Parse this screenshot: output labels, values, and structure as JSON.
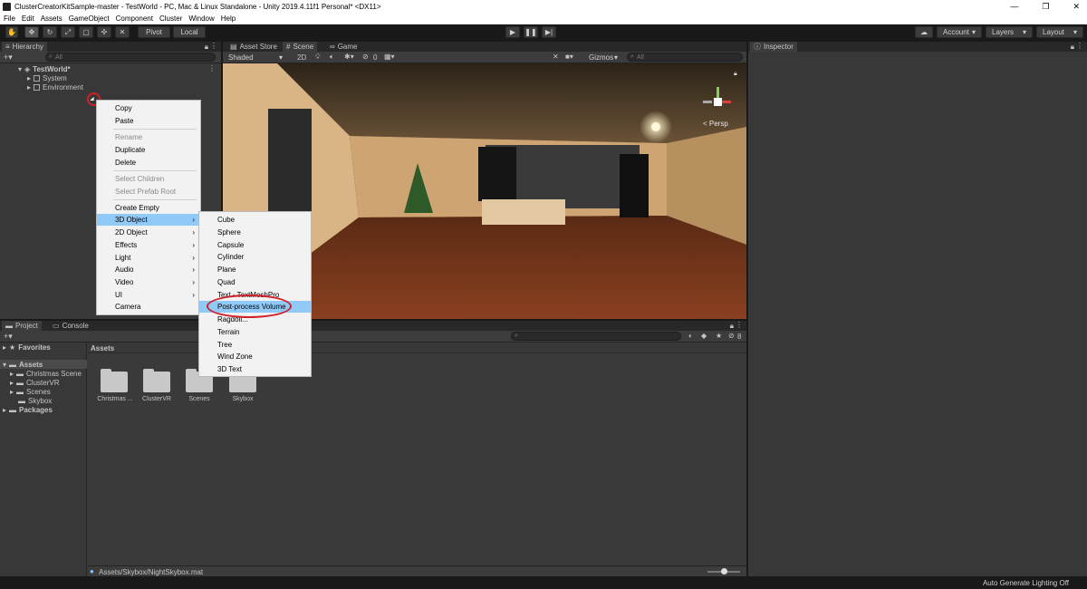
{
  "window": {
    "title": "ClusterCreatorKitSample-master - TestWorld - PC, Mac & Linux Standalone - Unity 2019.4.11f1 Personal* <DX11>"
  },
  "menubar": [
    "File",
    "Edit",
    "Assets",
    "GameObject",
    "Component",
    "Cluster",
    "Window",
    "Help"
  ],
  "toolbar": {
    "pivot": "Pivot",
    "local": "Local",
    "account": "Account",
    "layers": "Layers",
    "layout": "Layout"
  },
  "hierarchy": {
    "tab": "Hierarchy",
    "search_placeholder": "All",
    "scene": "TestWorld*",
    "items": [
      "System",
      "Environment"
    ]
  },
  "scene_view": {
    "tabs": [
      "Asset Store",
      "Scene",
      "Game"
    ],
    "shading": "Shaded",
    "mode_2d": "2D",
    "hidden_count": "0",
    "gizmos": "Gizmos",
    "search_placeholder": "All",
    "persp_label": "< Persp"
  },
  "inspector": {
    "tab": "Inspector"
  },
  "context_menu": {
    "items": [
      {
        "label": "Copy",
        "disabled": false
      },
      {
        "label": "Paste",
        "disabled": false
      },
      {
        "label": "Rename",
        "disabled": true
      },
      {
        "label": "Duplicate",
        "disabled": false
      },
      {
        "label": "Delete",
        "disabled": false
      },
      {
        "label": "Select Children",
        "disabled": true
      },
      {
        "label": "Select Prefab Root",
        "disabled": true
      },
      {
        "label": "Create Empty",
        "disabled": false
      },
      {
        "label": "3D Object",
        "disabled": false,
        "submenu": true
      },
      {
        "label": "2D Object",
        "disabled": false,
        "submenu": true
      },
      {
        "label": "Effects",
        "disabled": false,
        "submenu": true
      },
      {
        "label": "Light",
        "disabled": false,
        "submenu": true
      },
      {
        "label": "Audio",
        "disabled": false,
        "submenu": true
      },
      {
        "label": "Video",
        "disabled": false,
        "submenu": true
      },
      {
        "label": "UI",
        "disabled": false,
        "submenu": true
      },
      {
        "label": "Camera",
        "disabled": false
      }
    ]
  },
  "submenu_3d": {
    "items": [
      "Cube",
      "Sphere",
      "Capsule",
      "Cylinder",
      "Plane",
      "Quad",
      "Text - TextMeshPro",
      "Post-process Volume",
      "Ragdoll...",
      "Terrain",
      "Tree",
      "Wind Zone",
      "3D Text"
    ],
    "highlighted": "Post-process Volume"
  },
  "project": {
    "tabs": [
      "Project",
      "Console"
    ],
    "favorites": "Favorites",
    "assets_root": "Assets",
    "asset_folders": [
      "Christmas Scene",
      "ClusterVR",
      "Scenes",
      "Skybox"
    ],
    "packages": "Packages",
    "grid_title": "Assets",
    "grid_labels": [
      "Christmas ...",
      "ClusterVR",
      "Scenes",
      "Skybox"
    ],
    "hidden_count": "8",
    "footer_path": "Assets/Skybox/NightSkybox.mat"
  },
  "statusbar": {
    "right": "Auto Generate Lighting Off"
  },
  "colors": {
    "highlight": "#91c9f7",
    "annotation": "#d0202a",
    "editor_bg": "#383838"
  }
}
